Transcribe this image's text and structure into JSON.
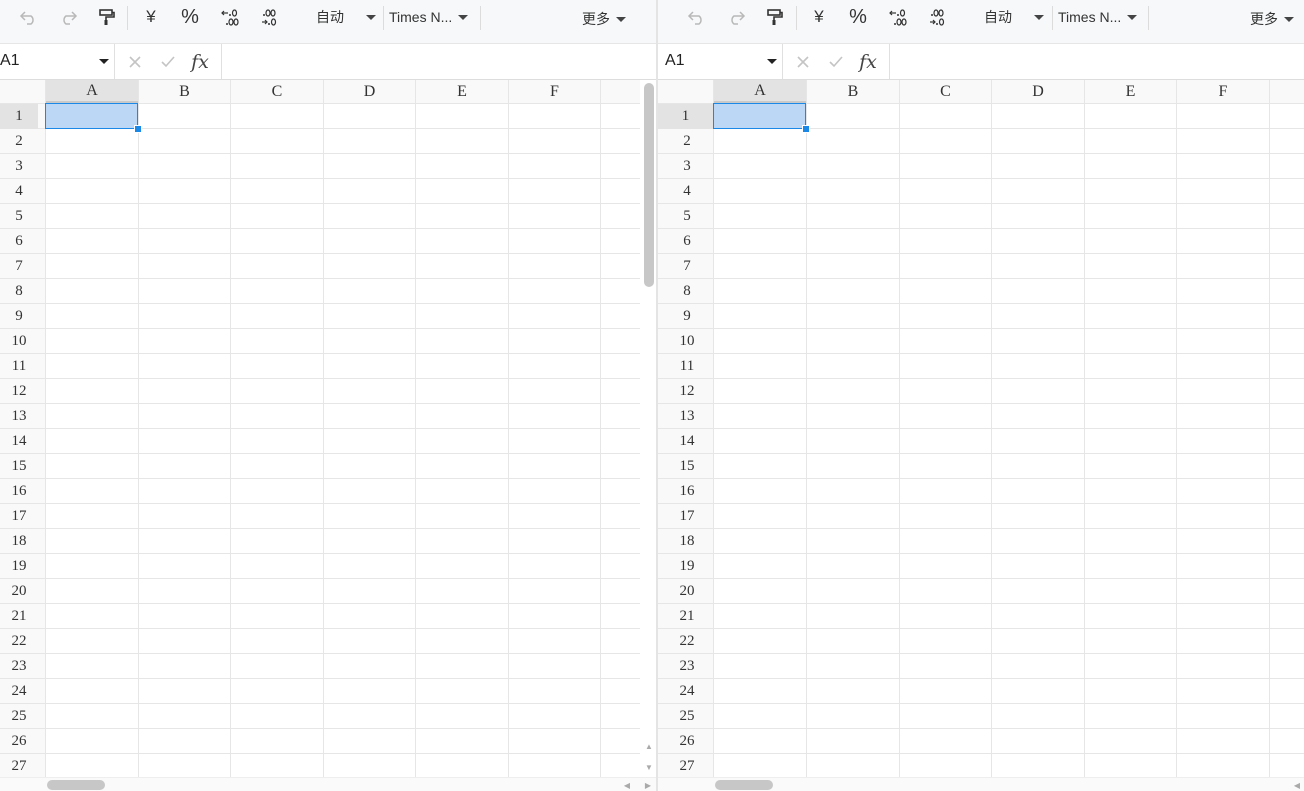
{
  "colors": {
    "accent": "#1a88e6",
    "selection_fill": "#bcd6f5",
    "header_active": "#e3e3e3",
    "gridline": "#e6e6e6",
    "toolbar_bg": "#f7f8fa"
  },
  "panes": [
    {
      "toolbar": {
        "undo_icon": "undo-icon",
        "redo_icon": "redo-icon",
        "format_painter_icon": "format-painter-icon",
        "currency_label": "¥",
        "percent_label": "%",
        "increase_decimal_icon": "increase-decimal-icon",
        "decrease_decimal_icon": "decrease-decimal-icon",
        "number_format_label": "自动",
        "font_name_label": "Times N...",
        "more_label": "更多"
      },
      "formula_bar": {
        "name_box_value": "A1",
        "cancel_icon": "cancel-x-icon",
        "confirm_icon": "confirm-check-icon",
        "fx_label": "fx",
        "formula_value": ""
      },
      "grid": {
        "columns": [
          "A",
          "B",
          "C",
          "D",
          "E",
          "F"
        ],
        "rows": [
          "1",
          "2",
          "3",
          "4",
          "5",
          "6",
          "7",
          "8",
          "9",
          "10",
          "11",
          "12",
          "13",
          "14",
          "15",
          "16",
          "17",
          "18",
          "19",
          "20",
          "21",
          "22",
          "23",
          "24",
          "25",
          "26",
          "27"
        ],
        "selected_cell": "A1"
      }
    },
    {
      "toolbar": {
        "undo_icon": "undo-icon",
        "redo_icon": "redo-icon",
        "format_painter_icon": "format-painter-icon",
        "currency_label": "¥",
        "percent_label": "%",
        "increase_decimal_icon": "increase-decimal-icon",
        "decrease_decimal_icon": "decrease-decimal-icon",
        "number_format_label": "自动",
        "font_name_label": "Times N...",
        "more_label": "更多"
      },
      "formula_bar": {
        "name_box_value": "A1",
        "cancel_icon": "cancel-x-icon",
        "confirm_icon": "confirm-check-icon",
        "fx_label": "fx",
        "formula_value": ""
      },
      "grid": {
        "columns": [
          "A",
          "B",
          "C",
          "D",
          "E",
          "F"
        ],
        "rows": [
          "1",
          "2",
          "3",
          "4",
          "5",
          "6",
          "7",
          "8",
          "9",
          "10",
          "11",
          "12",
          "13",
          "14",
          "15",
          "16",
          "17",
          "18",
          "19",
          "20",
          "21",
          "22",
          "23",
          "24",
          "25",
          "26",
          "27"
        ],
        "selected_cell": "A1"
      }
    }
  ]
}
